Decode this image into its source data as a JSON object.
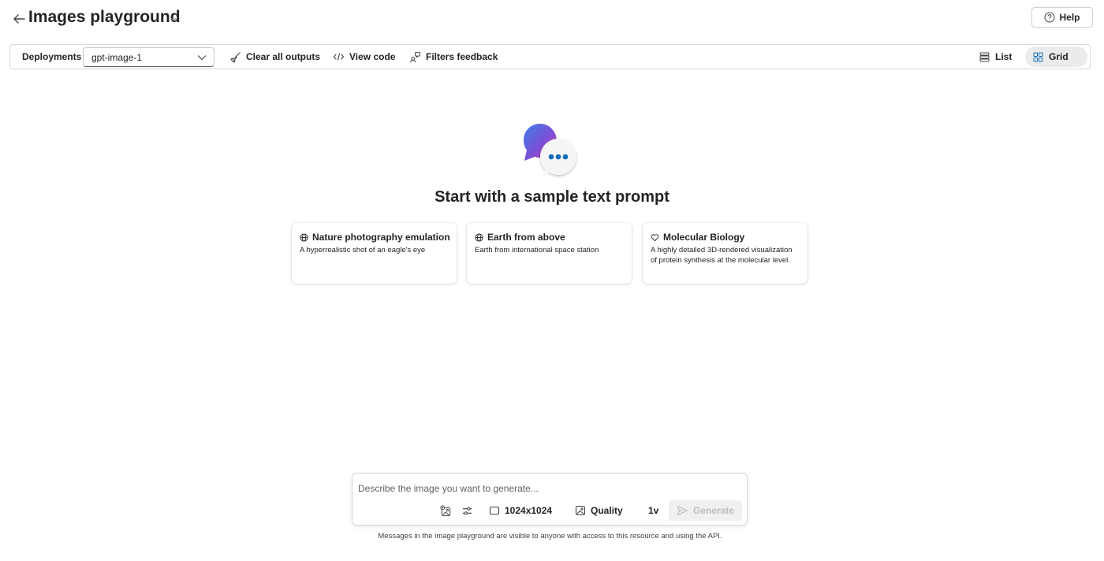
{
  "header": {
    "title": "Images playground",
    "help_label": "Help"
  },
  "toolbar": {
    "deployments_label": "Deployments",
    "deployment_selected": "gpt-image-1",
    "clear_label": "Clear all outputs",
    "view_code_label": "View code",
    "filters_label": "Filters feedback",
    "view_list_label": "List",
    "view_grid_label": "Grid",
    "active_view": "Grid"
  },
  "hero": {
    "title": "Start with a sample text prompt",
    "icon": "chat-bubbles-icon"
  },
  "samples": [
    {
      "icon": "globe-icon",
      "title": "Nature photography emulation",
      "description": "A hyperrealistic shot of an eagle's eye"
    },
    {
      "icon": "globe-icon",
      "title": "Earth from above",
      "description": "Earth from international space station"
    },
    {
      "icon": "heart-icon",
      "title": "Molecular Biology",
      "description": "A highly detailed 3D-rendered visualization of protein synthesis at the molecular level."
    }
  ],
  "composer": {
    "placeholder": "Describe the image you want to generate...",
    "size_label": "1024x1024",
    "quality_label": "Quality",
    "count_label": "1v",
    "generate_label": "Generate"
  },
  "footer": {
    "disclaimer": "Messages in the image playground are visible to anyone with access to this resource and using the API."
  },
  "colors": {
    "accent": "#0f6cbd",
    "hero_gradient_start": "#5b5fc7",
    "hero_gradient_end": "#e43ba6"
  }
}
